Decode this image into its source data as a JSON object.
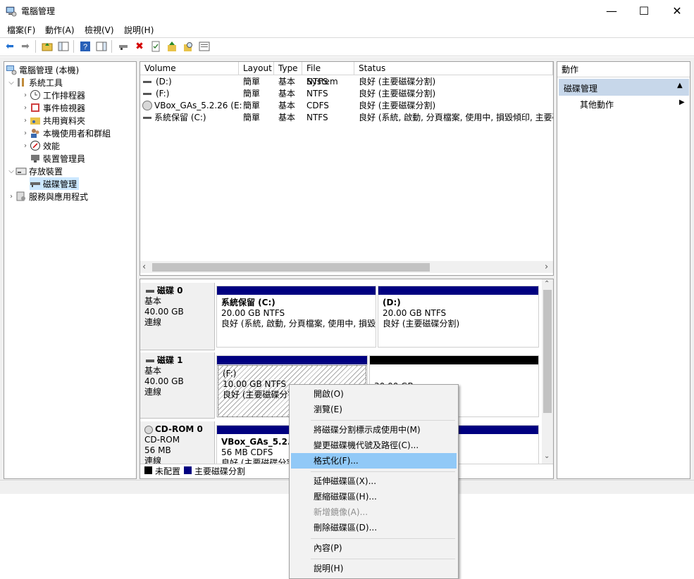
{
  "window": {
    "title": "電腦管理",
    "min": "—",
    "max": "☐",
    "close": "✕"
  },
  "menu": [
    "檔案(F)",
    "動作(A)",
    "檢視(V)",
    "說明(H)"
  ],
  "tree": {
    "root": "電腦管理 (本機)",
    "system_tools": "系統工具",
    "task_scheduler": "工作排程器",
    "event_viewer": "事件檢視器",
    "shared_folders": "共用資料夾",
    "local_users": "本機使用者和群組",
    "performance": "效能",
    "device_manager": "裝置管理員",
    "storage": "存放裝置",
    "disk_management": "磁碟管理",
    "services": "服務與應用程式"
  },
  "volumes": {
    "columns": [
      "Volume",
      "Layout",
      "Type",
      "File System",
      "Status"
    ],
    "rows": [
      {
        "volume": "(D:)",
        "layout": "簡單",
        "type": "基本",
        "fs": "NTFS",
        "status": "良好 (主要磁碟分割)"
      },
      {
        "volume": "(F:)",
        "layout": "簡單",
        "type": "基本",
        "fs": "NTFS",
        "status": "良好 (主要磁碟分割)"
      },
      {
        "volume": "VBox_GAs_5.2.26 (E:)",
        "layout": "簡單",
        "type": "基本",
        "fs": "CDFS",
        "status": "良好 (主要磁碟分割)"
      },
      {
        "volume": "系統保留 (C:)",
        "layout": "簡單",
        "type": "基本",
        "fs": "NTFS",
        "status": "良好 (系統, 啟動, 分頁檔案, 使用中, 損毀傾印, 主要磁碟"
      }
    ]
  },
  "disks": {
    "disk0": {
      "name": "磁碟 0",
      "type": "基本",
      "size": "40.00 GB",
      "status": "連線",
      "p1": {
        "name": "系統保留  (C:)",
        "size": "20.00 GB NTFS",
        "status": "良好 (系統, 啟動, 分頁檔案, 使用中, 損毀傾印"
      },
      "p2": {
        "name": "(D:)",
        "size": "20.00 GB NTFS",
        "status": "良好 (主要磁碟分割)"
      }
    },
    "disk1": {
      "name": "磁碟 1",
      "type": "基本",
      "size": "40.00 GB",
      "status": "連線",
      "p1": {
        "name": "(F:)",
        "size": "10.00 GB NTFS",
        "status": "良好 (主要磁碟分割)"
      },
      "p2": {
        "size": "30.00 GB"
      }
    },
    "cdrom0": {
      "name": "CD-ROM 0",
      "type": "CD-ROM",
      "size": "56 MB",
      "status": "連線",
      "p1": {
        "name": "VBox_GAs_5.2.26",
        "size": "56 MB CDFS",
        "status": "良好 (主要磁碟分割)"
      }
    }
  },
  "legend": {
    "unallocated": "未配置",
    "primary": "主要磁碟分割"
  },
  "actions": {
    "header": "動作",
    "section": "磁碟管理",
    "more": "其他動作"
  },
  "context_menu": {
    "open": "開啟(O)",
    "explore": "瀏覽(E)",
    "mark_active": "將磁碟分割標示成使用中(M)",
    "change_letter": "變更磁碟機代號及路徑(C)...",
    "format": "格式化(F)...",
    "extend": "延伸磁碟區(X)...",
    "shrink": "壓縮磁碟區(H)...",
    "add_mirror": "新增鏡像(A)...",
    "delete": "刪除磁碟區(D)...",
    "properties": "內容(P)",
    "help": "說明(H)"
  },
  "colors": {
    "primary_partition": "#000080",
    "unallocated": "#000000",
    "selection": "#91c9f7",
    "actions_section": "#c7d7ea"
  }
}
